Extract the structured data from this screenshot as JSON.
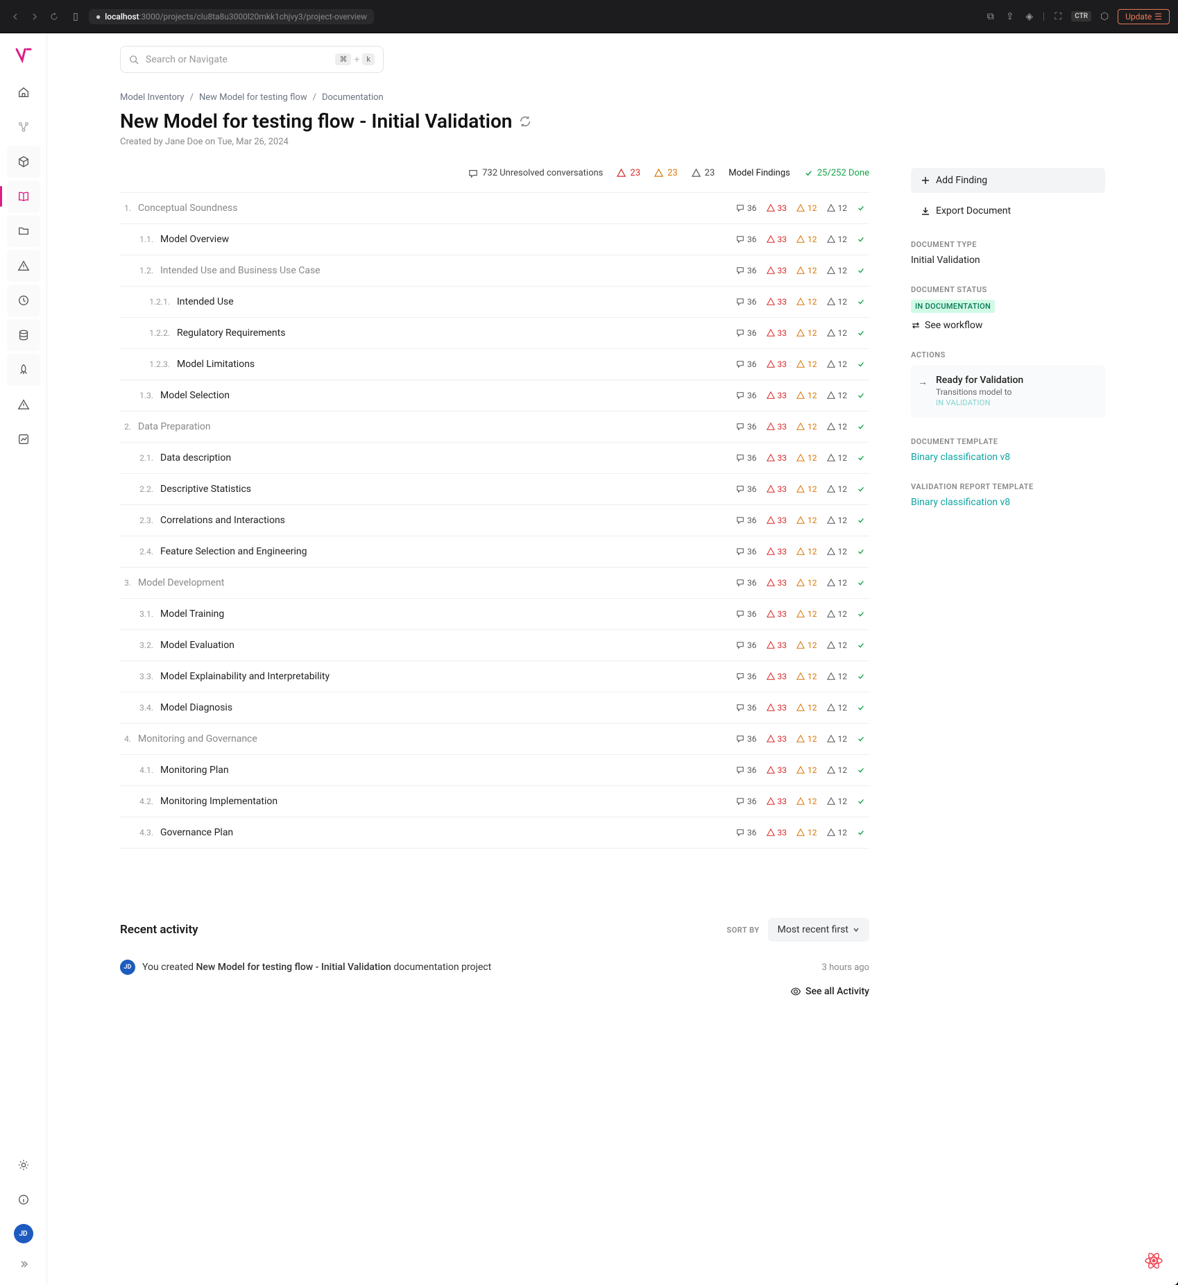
{
  "browser": {
    "url_host": "localhost",
    "url_path": ":3000/projects/clu8ta8u3000l20mkk1chjvy3/project-overview",
    "ctrl_label": "CTR",
    "update_label": "Update"
  },
  "sidebar": {
    "avatar_initials": "JD",
    "items": [
      {
        "name": "home",
        "active": false
      },
      {
        "name": "graph",
        "active": false,
        "muted": true
      },
      {
        "name": "cube",
        "active": true
      },
      {
        "name": "book",
        "active": true,
        "pink": true
      },
      {
        "name": "folder",
        "active": true
      },
      {
        "name": "warning",
        "active": true
      },
      {
        "name": "clock",
        "active": true
      },
      {
        "name": "database",
        "active": true
      },
      {
        "name": "rocket",
        "active": true
      },
      {
        "name": "warning2",
        "active": false
      },
      {
        "name": "chart",
        "active": false
      }
    ]
  },
  "search": {
    "placeholder": "Search or Navigate",
    "kbd1": "⌘",
    "plus": "+",
    "kbd2": "k"
  },
  "breadcrumb": [
    {
      "label": "Model Inventory"
    },
    {
      "label": "New Model for testing flow"
    },
    {
      "label": "Documentation"
    }
  ],
  "title": "New Model for testing flow - Initial Validation",
  "created_by": "Created by Jane Doe on Tue, Mar 26, 2024",
  "summary": {
    "unresolved": "732 Unresolved conversations",
    "red": "23",
    "orange": "23",
    "gray": "23",
    "findings_label": "Model Findings",
    "done": "25/252 Done"
  },
  "outline": [
    {
      "num": "1.",
      "title": "Conceptual Soundness",
      "depth": 0,
      "muted": true,
      "stats": {
        "c": "36",
        "r": "33",
        "o": "12",
        "g": "12"
      }
    },
    {
      "num": "1.1.",
      "title": "Model Overview",
      "depth": 1,
      "stats": {
        "c": "36",
        "r": "33",
        "o": "12",
        "g": "12"
      }
    },
    {
      "num": "1.2.",
      "title": "Intended Use and Business Use Case",
      "depth": 1,
      "muted": true,
      "stats": {
        "c": "36",
        "r": "33",
        "o": "12",
        "g": "12"
      }
    },
    {
      "num": "1.2.1.",
      "title": "Intended Use",
      "depth": 2,
      "stats": {
        "c": "36",
        "r": "33",
        "o": "12",
        "g": "12"
      }
    },
    {
      "num": "1.2.2.",
      "title": "Regulatory Requirements",
      "depth": 2,
      "stats": {
        "c": "36",
        "r": "33",
        "o": "12",
        "g": "12"
      }
    },
    {
      "num": "1.2.3.",
      "title": "Model Limitations",
      "depth": 2,
      "stats": {
        "c": "36",
        "r": "33",
        "o": "12",
        "g": "12"
      }
    },
    {
      "num": "1.3.",
      "title": "Model Selection",
      "depth": 1,
      "stats": {
        "c": "36",
        "r": "33",
        "o": "12",
        "g": "12"
      }
    },
    {
      "num": "2.",
      "title": "Data Preparation",
      "depth": 0,
      "muted": true,
      "stats": {
        "c": "36",
        "r": "33",
        "o": "12",
        "g": "12"
      }
    },
    {
      "num": "2.1.",
      "title": "Data description",
      "depth": 1,
      "stats": {
        "c": "36",
        "r": "33",
        "o": "12",
        "g": "12"
      }
    },
    {
      "num": "2.2.",
      "title": "Descriptive Statistics",
      "depth": 1,
      "stats": {
        "c": "36",
        "r": "33",
        "o": "12",
        "g": "12"
      }
    },
    {
      "num": "2.3.",
      "title": "Correlations and Interactions",
      "depth": 1,
      "stats": {
        "c": "36",
        "r": "33",
        "o": "12",
        "g": "12"
      }
    },
    {
      "num": "2.4.",
      "title": "Feature Selection and Engineering",
      "depth": 1,
      "stats": {
        "c": "36",
        "r": "33",
        "o": "12",
        "g": "12"
      }
    },
    {
      "num": "3.",
      "title": "Model Development",
      "depth": 0,
      "muted": true,
      "stats": {
        "c": "36",
        "r": "33",
        "o": "12",
        "g": "12"
      }
    },
    {
      "num": "3.1.",
      "title": "Model Training",
      "depth": 1,
      "stats": {
        "c": "36",
        "r": "33",
        "o": "12",
        "g": "12"
      }
    },
    {
      "num": "3.2.",
      "title": "Model Evaluation",
      "depth": 1,
      "stats": {
        "c": "36",
        "r": "33",
        "o": "12",
        "g": "12"
      }
    },
    {
      "num": "3.3.",
      "title": "Model Explainability and Interpretability",
      "depth": 1,
      "stats": {
        "c": "36",
        "r": "33",
        "o": "12",
        "g": "12"
      }
    },
    {
      "num": "3.4.",
      "title": "Model Diagnosis",
      "depth": 1,
      "stats": {
        "c": "36",
        "r": "33",
        "o": "12",
        "g": "12"
      }
    },
    {
      "num": "4.",
      "title": "Monitoring and Governance",
      "depth": 0,
      "muted": true,
      "stats": {
        "c": "36",
        "r": "33",
        "o": "12",
        "g": "12"
      }
    },
    {
      "num": "4.1.",
      "title": "Monitoring Plan",
      "depth": 1,
      "stats": {
        "c": "36",
        "r": "33",
        "o": "12",
        "g": "12"
      }
    },
    {
      "num": "4.2.",
      "title": "Monitoring Implementation",
      "depth": 1,
      "stats": {
        "c": "36",
        "r": "33",
        "o": "12",
        "g": "12"
      }
    },
    {
      "num": "4.3.",
      "title": "Governance Plan",
      "depth": 1,
      "stats": {
        "c": "36",
        "r": "33",
        "o": "12",
        "g": "12"
      }
    }
  ],
  "right": {
    "add_finding": "Add Finding",
    "export_document": "Export Document",
    "doc_type_label": "DOCUMENT TYPE",
    "doc_type": "Initial Validation",
    "doc_status_label": "DOCUMENT STATUS",
    "doc_status": "IN DOCUMENTATION",
    "see_workflow": "See workflow",
    "actions_label": "ACTIONS",
    "validation_title": "Ready for Validation",
    "validation_desc": "Transitions model to",
    "in_validation": "IN VALIDATION",
    "doc_template_label": "DOCUMENT TEMPLATE",
    "doc_template": "Binary classification v8",
    "report_template_label": "VALIDATION REPORT TEMPLATE",
    "report_template": "Binary classification v8"
  },
  "activity": {
    "title": "Recent activity",
    "sort_label": "SORT BY",
    "sort_value": "Most recent first",
    "avatar": "JD",
    "prefix": "You created ",
    "bold": "New Model for testing flow - Initial Validation",
    "suffix": " documentation project",
    "time": "3 hours ago",
    "see_all": "See all Activity"
  }
}
